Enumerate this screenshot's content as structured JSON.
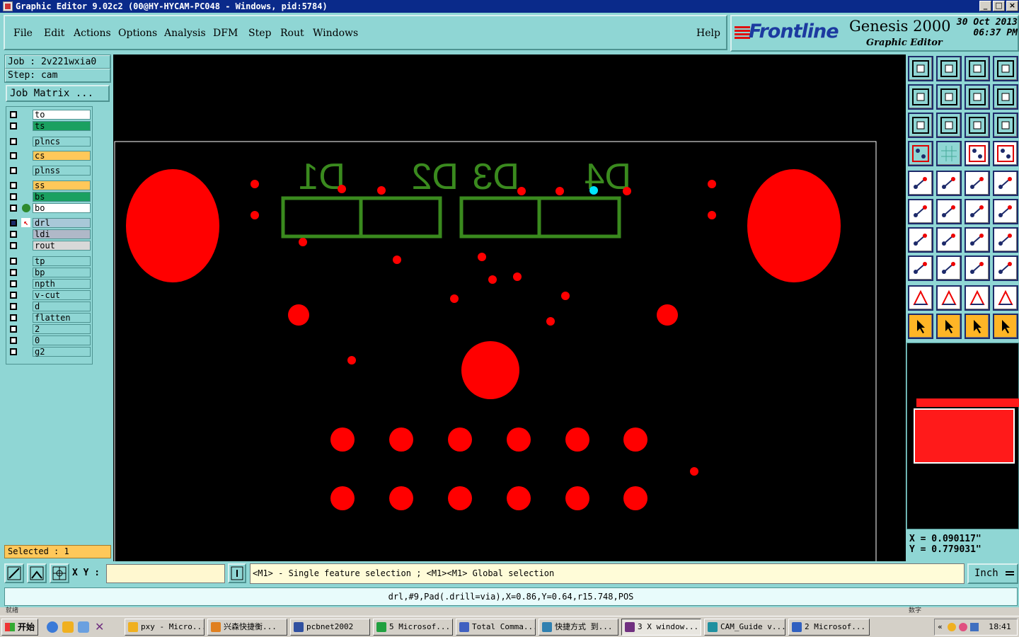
{
  "window": {
    "title": "Graphic Editor 9.02c2 (00@HY-HYCAM-PC048 - Windows, pid:5784)",
    "controls": [
      "_",
      "□",
      "×"
    ]
  },
  "menu": [
    "File",
    "Edit",
    "Actions",
    "Options",
    "Analysis",
    "DFM",
    "Step",
    "Rout",
    "Windows"
  ],
  "help_label": "Help",
  "brand": {
    "logo": "Frontline",
    "product": "Genesis 2000",
    "subtitle": "Graphic Editor",
    "date": "30 Oct 2013",
    "time": "06:37 PM"
  },
  "job": {
    "job_line": "Job : 2v221wxia0",
    "step_line": "Step: cam",
    "matrix_button": "Job Matrix ..."
  },
  "layers": [
    {
      "name": "to",
      "color": "#ffffff",
      "arrow": true
    },
    {
      "name": "ts",
      "color": "#1aa060",
      "arrow": true
    },
    {
      "name": "plncs",
      "color": "#8fd6d4",
      "arrow": false
    },
    {
      "name": "cs",
      "color": "#ffc85a",
      "arrow": false
    },
    {
      "name": "plnss",
      "color": "#8fd6d4",
      "arrow": false
    },
    {
      "name": "ss",
      "color": "#ffc85a",
      "arrow": true
    },
    {
      "name": "bs",
      "color": "#1aa060",
      "arrow": true
    },
    {
      "name": "bo",
      "color": "#ffffff",
      "arrow": false,
      "dot": true
    },
    {
      "name": "drl",
      "color": "#a8c8d8",
      "arrow": false,
      "work": true
    },
    {
      "name": "ldi",
      "color": "#b0b8c8",
      "arrow": false
    },
    {
      "name": "rout",
      "color": "#d8d8d8",
      "arrow": false
    },
    {
      "name": "tp",
      "color": "#8fd6d4",
      "arrow": false
    },
    {
      "name": "bp",
      "color": "#8fd6d4",
      "arrow": false
    },
    {
      "name": "npth",
      "color": "#8fd6d4",
      "arrow": false
    },
    {
      "name": "v-cut",
      "color": "#8fd6d4",
      "arrow": false
    },
    {
      "name": "d",
      "color": "#8fd6d4",
      "arrow": false
    },
    {
      "name": "flatten",
      "color": "#8fd6d4",
      "arrow": false
    },
    {
      "name": "2",
      "color": "#8fd6d4",
      "arrow": false
    },
    {
      "name": "0",
      "color": "#8fd6d4",
      "arrow": false
    },
    {
      "name": "g2",
      "color": "#8fd6d4",
      "arrow": false
    }
  ],
  "selected_text": "Selected : 1",
  "board": {
    "labels": [
      "D1",
      "D2",
      "D3",
      "D4"
    ],
    "pad_color": "#ff0000",
    "silk_color": "#3a8a1e",
    "highlight_color": "#00e5ff"
  },
  "coords": {
    "x": "X = 0.090117\"",
    "y": "Y = 0.779031\""
  },
  "cmd": {
    "xy_label": "X Y :",
    "xy_value": "",
    "prompt": "<M1> - Single feature selection ; <M1><M1> Global selection",
    "unit": "Inch"
  },
  "info": "drl,#9,Pad(.drill=via),X=0.86,Y=0.64,r15.748,POS",
  "status": {
    "left": "就绪",
    "right": "数字"
  },
  "taskbar": {
    "start": "开始",
    "tasks": [
      "pxy - Micro...",
      "兴森快捷衡...",
      "pcbnet2002",
      "5 Microsof...",
      "Total Comma...",
      "快捷方式 到...",
      "3 X window...",
      "CAM_Guide v...",
      "2 Microsof..."
    ],
    "clock": "18:41"
  }
}
